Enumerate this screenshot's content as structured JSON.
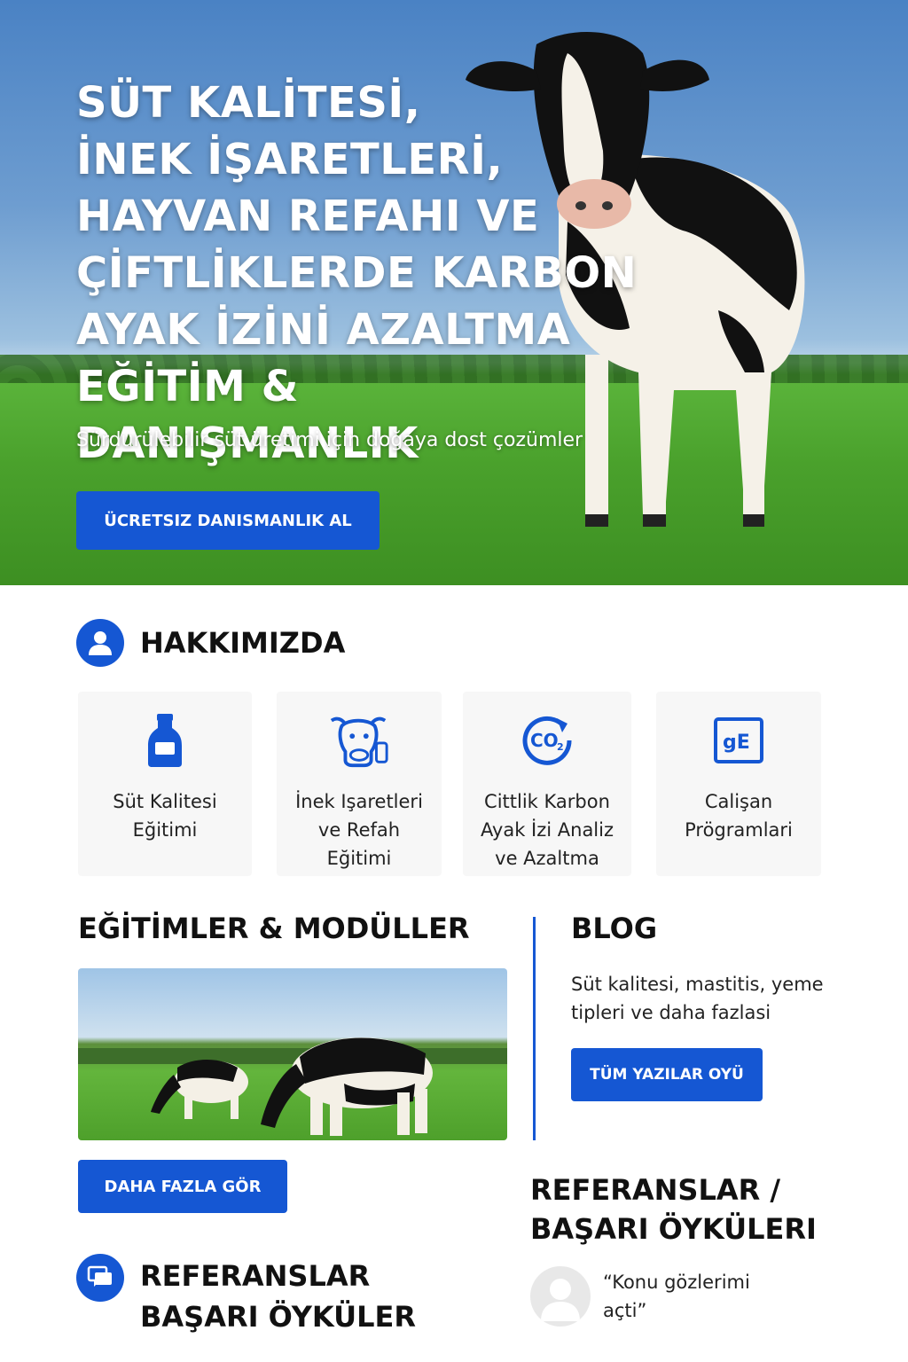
{
  "hero": {
    "title": "SÜT KALİTESİ,\nİNEK İŞARETLERİ,\nHAYVAN REFAHI VE\nÇİFTLİKLERDE KARBON\nAYAK İZİNİ AZALTMA\nEĞİTİM & DANIŞMANLIK",
    "subtitle": "Sürdurülebilir süt üretimi için doğaya dost çozümler",
    "cta_label": "ÜCRETSIZ DANISMANLIK AL"
  },
  "about": {
    "title": "HAKKIMIZDA",
    "cards": [
      {
        "icon": "milk-bottle-icon",
        "label": "Süt Kalitesi\nEğitimi"
      },
      {
        "icon": "cow-icon",
        "label": "İnek Işaretleri\nve Refah\nEğitimi"
      },
      {
        "icon": "co2-icon",
        "label": "Cittlik Karbon\nAyak İzi Analiz\nve Azaltma"
      },
      {
        "icon": "id-card-icon",
        "label": "Calişan\nPrögramlari"
      }
    ]
  },
  "education": {
    "title": "EĞİTİMLER & MODÜLLER",
    "button_label": "DAHA FAZLA GÖR"
  },
  "blog": {
    "title": "BLOG",
    "text": "Süt kalitesi, mastitis, yeme tipleri ve daha fazlasi",
    "button_label": "TÜM YAZILAR OYÜ"
  },
  "references_right": {
    "title": "REFERANSLAR /\nBAŞARI ÖYKÜLERI",
    "quote": "“Konu gözlerimi açti”"
  },
  "references_left": {
    "title": "REFERANSLAR\nBAŞARI ÖYKÜLER"
  },
  "colors": {
    "accent": "#1557d3",
    "card_bg": "#f7f7f7"
  }
}
